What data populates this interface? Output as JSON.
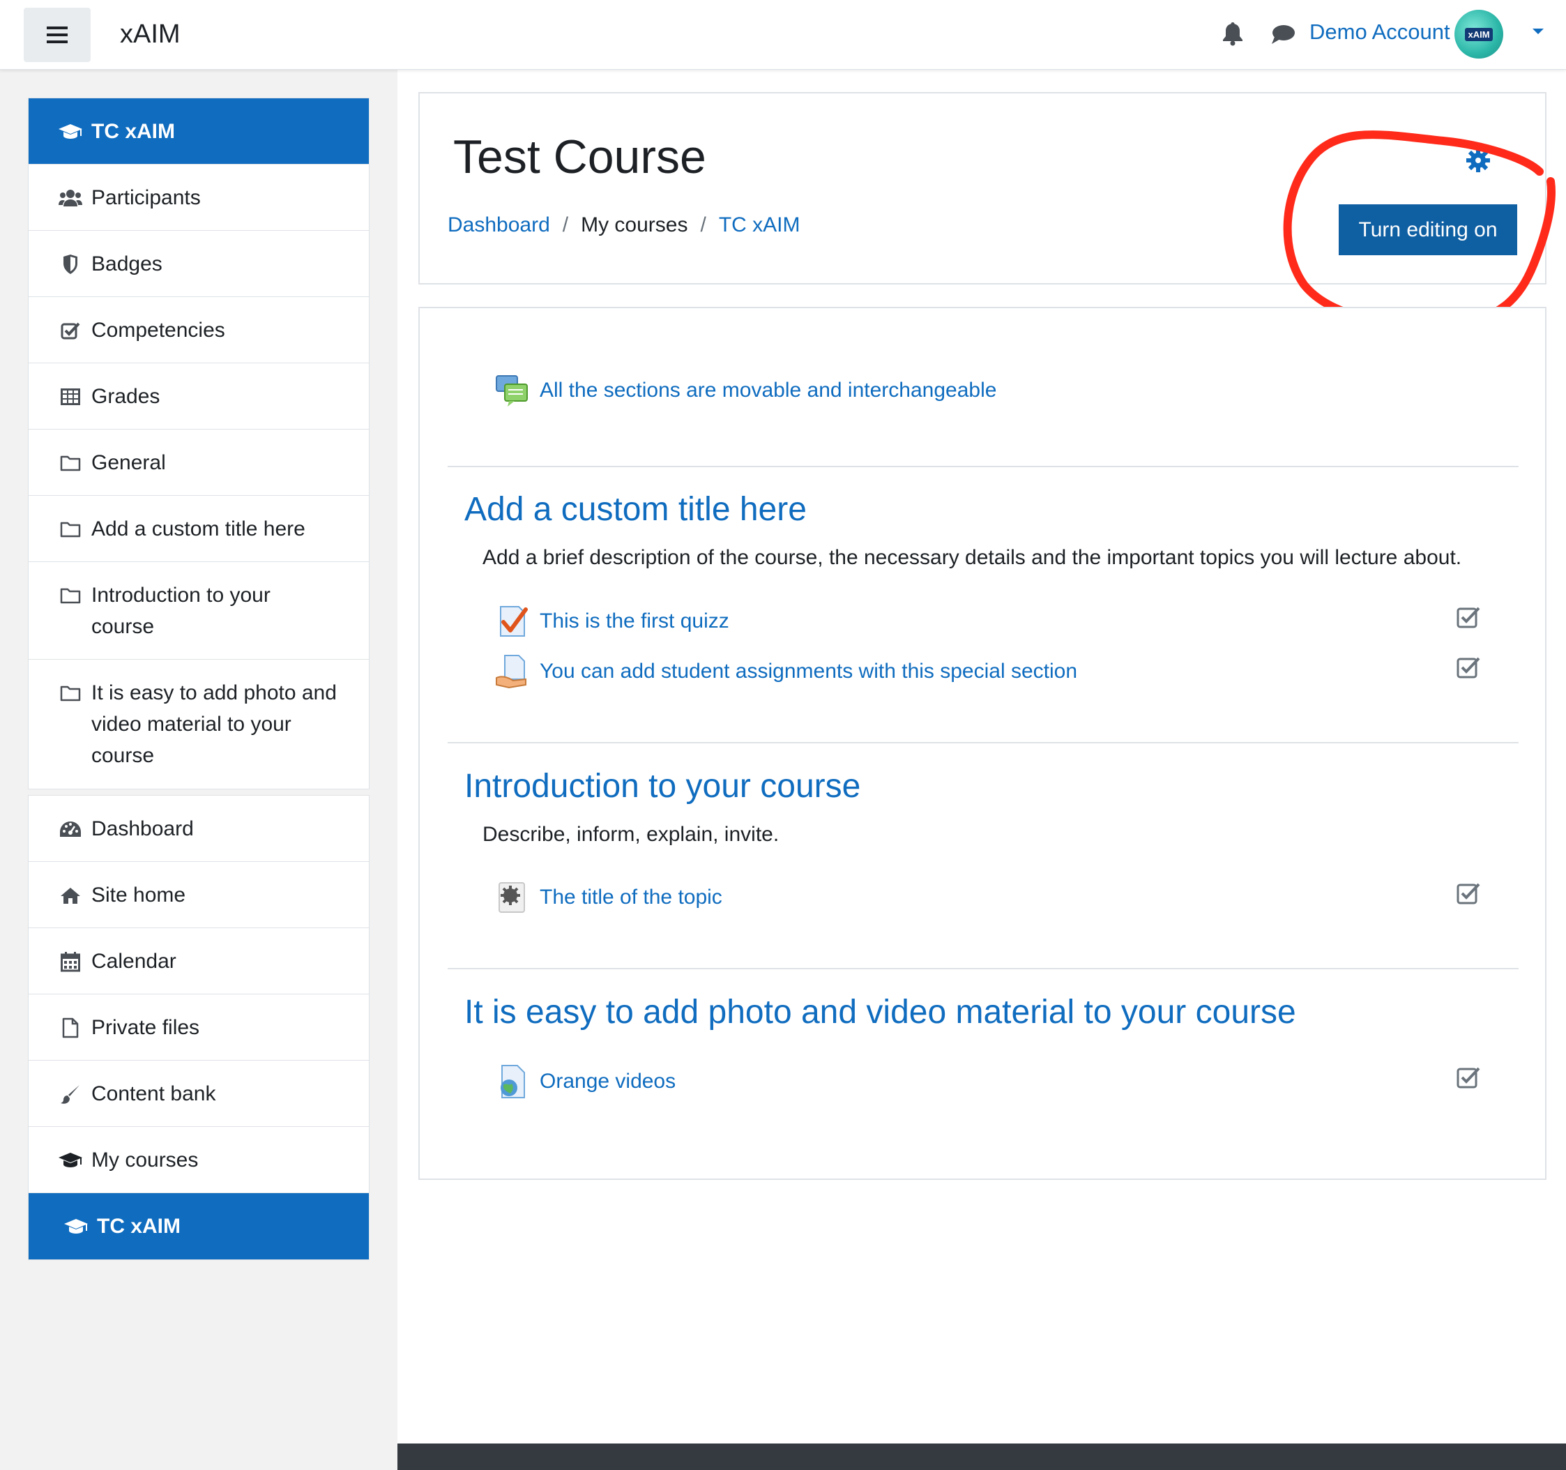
{
  "navbar": {
    "brand": "xAIM",
    "user_name": "Demo Account",
    "avatar_text": "xAIM"
  },
  "sidebar": {
    "course_group": [
      {
        "label": "TC xAIM",
        "icon": "graduation-cap-icon",
        "active": true
      },
      {
        "label": "Participants",
        "icon": "users-icon"
      },
      {
        "label": "Badges",
        "icon": "shield-icon"
      },
      {
        "label": "Competencies",
        "icon": "check-square-icon"
      },
      {
        "label": "Grades",
        "icon": "table-icon"
      },
      {
        "label": "General",
        "icon": "folder-icon"
      },
      {
        "label": "Add a custom title here",
        "icon": "folder-icon"
      },
      {
        "label": "Introduction to your course",
        "icon": "folder-icon"
      },
      {
        "label": "It is easy to add photo and video material to your course",
        "icon": "folder-icon"
      }
    ],
    "site_group": [
      {
        "label": "Dashboard",
        "icon": "dashboard-icon"
      },
      {
        "label": "Site home",
        "icon": "home-icon"
      },
      {
        "label": "Calendar",
        "icon": "calendar-icon"
      },
      {
        "label": "Private files",
        "icon": "file-icon"
      },
      {
        "label": "Content bank",
        "icon": "paintbrush-icon"
      },
      {
        "label": "My courses",
        "icon": "graduation-cap-icon"
      },
      {
        "label": "TC xAIM",
        "icon": "graduation-cap-icon",
        "active": true
      }
    ]
  },
  "header": {
    "title": "Test Course",
    "breadcrumb": [
      "Dashboard",
      "My courses",
      "TC xAIM"
    ],
    "edit_button": "Turn editing on"
  },
  "content": {
    "general_activity": "All the sections are movable and interchangeable",
    "sections": [
      {
        "title": "Add a custom title here",
        "summary": "Add a brief description of the course, the necessary details and the important topics you will lecture about.",
        "activities": [
          "This is the first quizz",
          "You can add student assignments with this special section"
        ]
      },
      {
        "title": "Introduction to your course",
        "summary": "Describe, inform, explain, invite.",
        "activities": [
          "The title of the topic"
        ]
      },
      {
        "title": "It is easy to add photo and video material to your course",
        "summary": "",
        "activities": [
          "Orange videos"
        ]
      }
    ]
  },
  "colors": {
    "accent": "#0f6cbf",
    "button": "#0f5fa3",
    "annotation": "#ff2a1a",
    "sidebar_bg": "#f2f2f2",
    "footer": "#343a40"
  }
}
